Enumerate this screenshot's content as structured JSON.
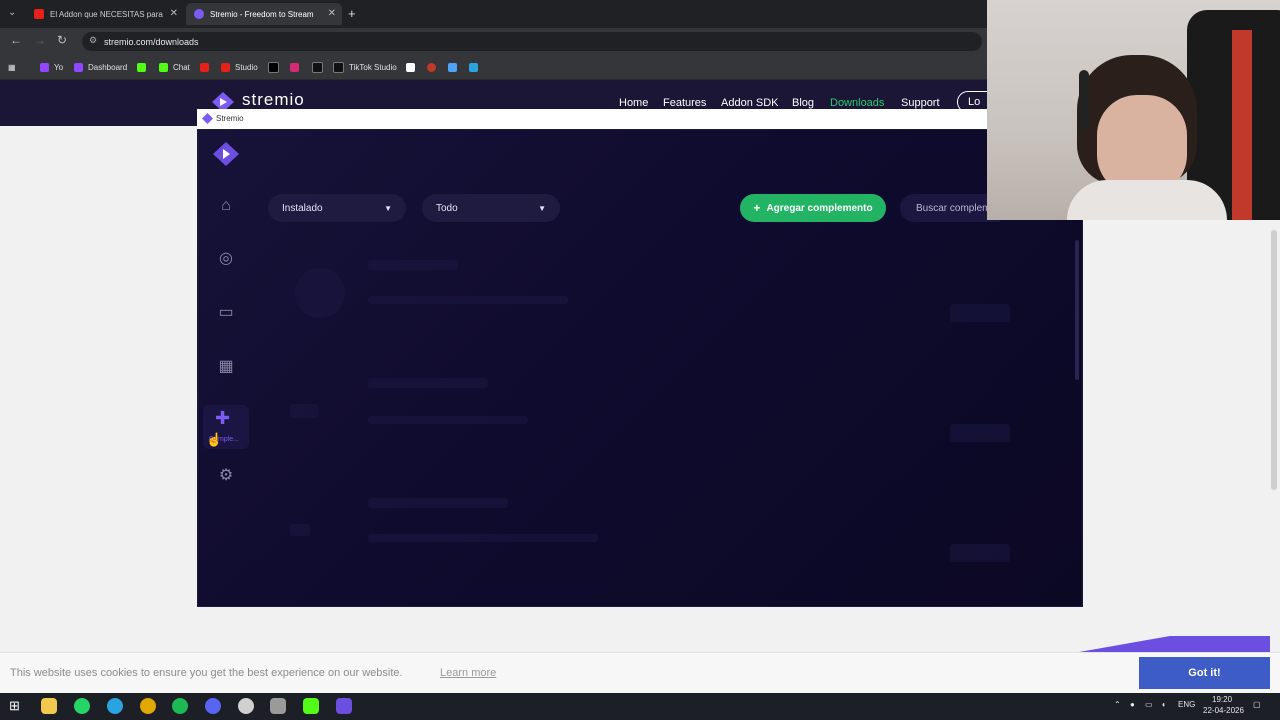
{
  "browser": {
    "tabs": [
      {
        "title": "El Addon que NECESITAS para"
      },
      {
        "title": "Stremio - Freedom to Stream"
      }
    ],
    "new_tab": "+",
    "url": "stremio.com/downloads",
    "bookmarks": [
      "Yo",
      "Dashboard",
      "Chat",
      "Studio",
      "TikTok Studio"
    ]
  },
  "site": {
    "logo": "stremio",
    "nav": [
      "Home",
      "Features",
      "Addon SDK",
      "Blog",
      "Downloads",
      "Support"
    ],
    "login": "Lo",
    "accent": "#2ecc71"
  },
  "stremio": {
    "window_title": "Stremio",
    "sidebar": {
      "active_label": "Comple..."
    },
    "filters": {
      "installed": "Instalado",
      "all": "Todo"
    },
    "add_button": "Agregar complemento",
    "search_placeholder": "Buscar complem"
  },
  "cookie": {
    "text": "This website uses cookies to ensure you get the best experience on our website.",
    "learn_more": "Learn more",
    "button": "Got it!"
  },
  "taskbar": {
    "lang": "ENG",
    "time": "19:20",
    "date": "22-04-2026"
  }
}
